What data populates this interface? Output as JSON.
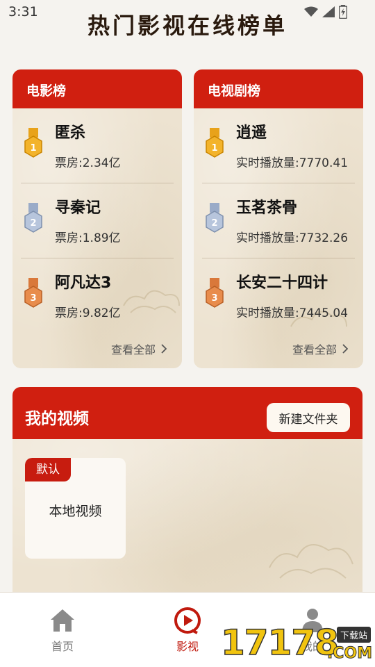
{
  "status_bar": {
    "time": "3:31"
  },
  "page_title": "热门影视在线榜单",
  "movie_board": {
    "title": "电影榜",
    "items": [
      {
        "rank": "1",
        "name": "匿杀",
        "stat": "票房:2.34亿"
      },
      {
        "rank": "2",
        "name": "寻秦记",
        "stat": "票房:1.89亿"
      },
      {
        "rank": "3",
        "name": "阿凡达3",
        "stat": "票房:9.82亿"
      }
    ],
    "see_all": "查看全部"
  },
  "tv_board": {
    "title": "电视剧榜",
    "items": [
      {
        "rank": "1",
        "name": "逍遥",
        "stat": "实时播放量:7770.41"
      },
      {
        "rank": "2",
        "name": "玉茗茶骨",
        "stat": "实时播放量:7732.26"
      },
      {
        "rank": "3",
        "name": "长安二十四计",
        "stat": "实时播放量:7445.04"
      }
    ],
    "see_all": "查看全部"
  },
  "my_video": {
    "title": "我的视频",
    "new_folder_label": "新建文件夹",
    "folders": [
      {
        "badge": "默认",
        "name": "本地视频"
      }
    ]
  },
  "bottom_nav": {
    "items": [
      {
        "label": "首页",
        "icon": "home-icon",
        "active": false
      },
      {
        "label": "影视",
        "icon": "play-icon",
        "active": true
      },
      {
        "label": "我的",
        "icon": "user-icon",
        "active": false
      }
    ]
  },
  "watermark": {
    "digits": "17178",
    "tag": "下载站",
    "suffix": ".COM"
  },
  "colors": {
    "accent_red": "#d01f10",
    "gold": "#e8a21a",
    "silver": "#9aabc8",
    "bronze": "#d9783a",
    "paper": "#ede3d1"
  }
}
